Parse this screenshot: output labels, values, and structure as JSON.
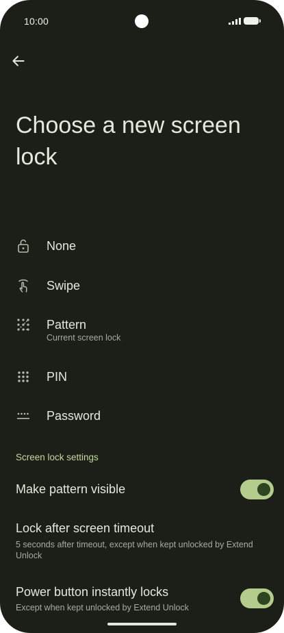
{
  "status_bar": {
    "time": "10:00"
  },
  "page": {
    "title": "Choose a new screen lock"
  },
  "options": [
    {
      "label": "None",
      "icon": "lock-open-icon"
    },
    {
      "label": "Swipe",
      "icon": "swipe-icon"
    },
    {
      "label": "Pattern",
      "sublabel": "Current screen lock",
      "icon": "pattern-icon"
    },
    {
      "label": "PIN",
      "icon": "pin-icon"
    },
    {
      "label": "Password",
      "icon": "password-icon"
    }
  ],
  "settings": {
    "section_title": "Screen lock settings",
    "make_pattern_visible": {
      "label": "Make pattern visible",
      "enabled": true
    },
    "lock_after_timeout": {
      "label": "Lock after screen timeout",
      "sublabel": "5 seconds after timeout, except when kept unlocked by Extend Unlock"
    },
    "power_button_locks": {
      "label": "Power button instantly locks",
      "sublabel": "Except when kept unlocked by Extend Unlock",
      "enabled": true
    }
  },
  "colors": {
    "background": "#1c1f18",
    "accent": "#b4cd8d",
    "section": "#c4d8a0"
  }
}
